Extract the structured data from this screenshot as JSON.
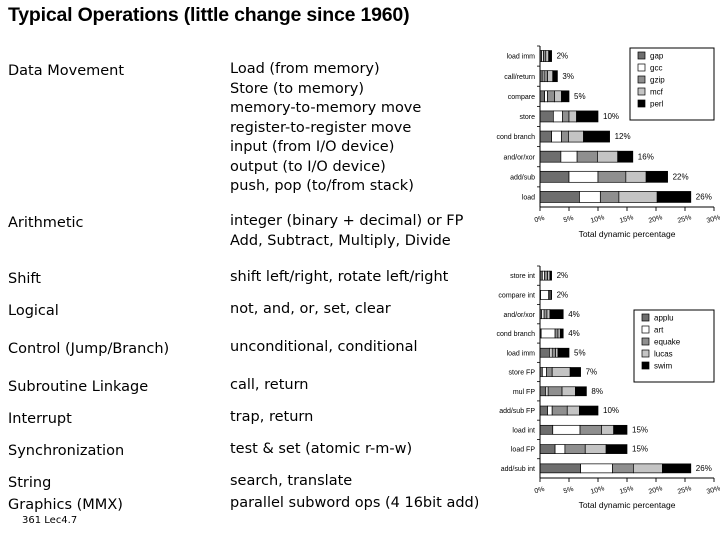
{
  "slide": {
    "title": "Typical Operations (little change since 1960)",
    "footer": "361  Lec4.7"
  },
  "operations": [
    {
      "category": "Data Movement",
      "description": "Load (from memory)\nStore (to memory)\nmemory-to-memory move\nregister-to-register move\ninput (from I/O device)\noutput (to I/O device)\npush, pop (to/from stack)"
    },
    {
      "category": "Arithmetic",
      "description": "integer (binary + decimal) or FP\nAdd, Subtract, Multiply, Divide"
    },
    {
      "category": "Shift",
      "description": "shift left/right, rotate left/right"
    },
    {
      "category": "Logical",
      "description": "not, and, or, set, clear"
    },
    {
      "category": "Control (Jump/Branch)",
      "description": "unconditional, conditional"
    },
    {
      "category": "Subroutine Linkage",
      "description": "call, return"
    },
    {
      "category": "Interrupt",
      "description": "trap, return"
    },
    {
      "category": "Synchronization",
      "description": "test & set (atomic r-m-w)"
    },
    {
      "category": "String",
      "description": "search, translate"
    },
    {
      "category": "Graphics (MMX)",
      "description": "parallel subword ops (4 16bit add)"
    }
  ],
  "chart_data": [
    {
      "id": "integer-programs",
      "type": "bar",
      "orientation": "horizontal",
      "stacked": true,
      "title": "",
      "xlabel": "Total dynamic percentage",
      "ylabel": "",
      "xlim": [
        0,
        30
      ],
      "xticks": [
        0,
        5,
        10,
        15,
        20,
        25,
        30
      ],
      "xticklabels": [
        "0%",
        "5%",
        "10%",
        "15%",
        "20%",
        "25%",
        "30%"
      ],
      "grid": false,
      "legend_position": "upper-right",
      "categories": [
        "load imm",
        "call/return",
        "compare",
        "store",
        "cond branch",
        "and/or/xor",
        "add/sub",
        "load"
      ],
      "bar_totals": [
        2,
        3,
        5,
        10,
        12,
        16,
        22,
        26
      ],
      "bar_total_labels": [
        "2%",
        "3%",
        "5%",
        "10%",
        "12%",
        "16%",
        "22%",
        "26%"
      ],
      "series": [
        {
          "name": "gap",
          "color": "#6e6e6e",
          "values": [
            0.3,
            0.4,
            0.8,
            2.3,
            2.0,
            3.6,
            5.0,
            6.8
          ]
        },
        {
          "name": "gcc",
          "color": "#ffffff",
          "values": [
            0.3,
            0.3,
            0.5,
            1.6,
            1.7,
            2.8,
            5.0,
            3.6
          ]
        },
        {
          "name": "gzip",
          "color": "#8f8f8f",
          "values": [
            0.4,
            0.6,
            1.2,
            1.1,
            1.2,
            3.5,
            4.8,
            3.2
          ]
        },
        {
          "name": "mcf",
          "color": "#c4c4c4",
          "values": [
            0.5,
            0.9,
            1.2,
            1.3,
            2.6,
            3.5,
            3.5,
            6.6
          ]
        },
        {
          "name": "perl",
          "color": "#000000",
          "values": [
            0.5,
            0.8,
            1.3,
            3.7,
            4.5,
            2.6,
            3.7,
            5.8
          ]
        }
      ]
    },
    {
      "id": "floating-point-programs",
      "type": "bar",
      "orientation": "horizontal",
      "stacked": true,
      "title": "",
      "xlabel": "Total dynamic percentage",
      "ylabel": "",
      "xlim": [
        0,
        30
      ],
      "xticks": [
        0,
        5,
        10,
        15,
        20,
        25,
        30
      ],
      "xticklabels": [
        "0%",
        "5%",
        "10%",
        "15%",
        "20%",
        "25%",
        "30%"
      ],
      "grid": false,
      "legend_position": "upper-right",
      "categories": [
        "store int",
        "compare int",
        "and/or/xor",
        "cond branch",
        "load imm",
        "store FP",
        "mul FP",
        "add/sub FP",
        "load int",
        "load FP",
        "add/sub int"
      ],
      "bar_totals": [
        2,
        2,
        4,
        4,
        5,
        7,
        8,
        10,
        15,
        15,
        26
      ],
      "bar_total_labels": [
        "2%",
        "2%",
        "4%",
        "4%",
        "5%",
        "7%",
        "8%",
        "10%",
        "15%",
        "15%",
        "26%"
      ],
      "series": [
        {
          "name": "applu",
          "color": "#6e6e6e",
          "values": [
            0.4,
            0.1,
            0.3,
            0.2,
            1.7,
            0.4,
            1.0,
            1.3,
            2.2,
            2.6,
            7.0
          ]
        },
        {
          "name": "art",
          "color": "#ffffff",
          "values": [
            0.4,
            1.4,
            0.4,
            2.4,
            0.4,
            0.7,
            0.4,
            0.8,
            4.7,
            1.7,
            5.5
          ]
        },
        {
          "name": "equake",
          "color": "#8f8f8f",
          "values": [
            0.5,
            0.2,
            0.5,
            0.5,
            0.6,
            1.0,
            2.4,
            2.6,
            3.7,
            3.5,
            3.6
          ]
        },
        {
          "name": "lucas",
          "color": "#c4c4c4",
          "values": [
            0.4,
            0.2,
            0.5,
            0.4,
            0.4,
            3.1,
            2.3,
            2.1,
            2.1,
            3.6,
            5.0
          ]
        },
        {
          "name": "swim",
          "color": "#000000",
          "values": [
            0.3,
            0.1,
            2.3,
            0.5,
            1.9,
            1.8,
            1.9,
            3.2,
            2.3,
            3.6,
            4.9
          ]
        }
      ]
    }
  ]
}
